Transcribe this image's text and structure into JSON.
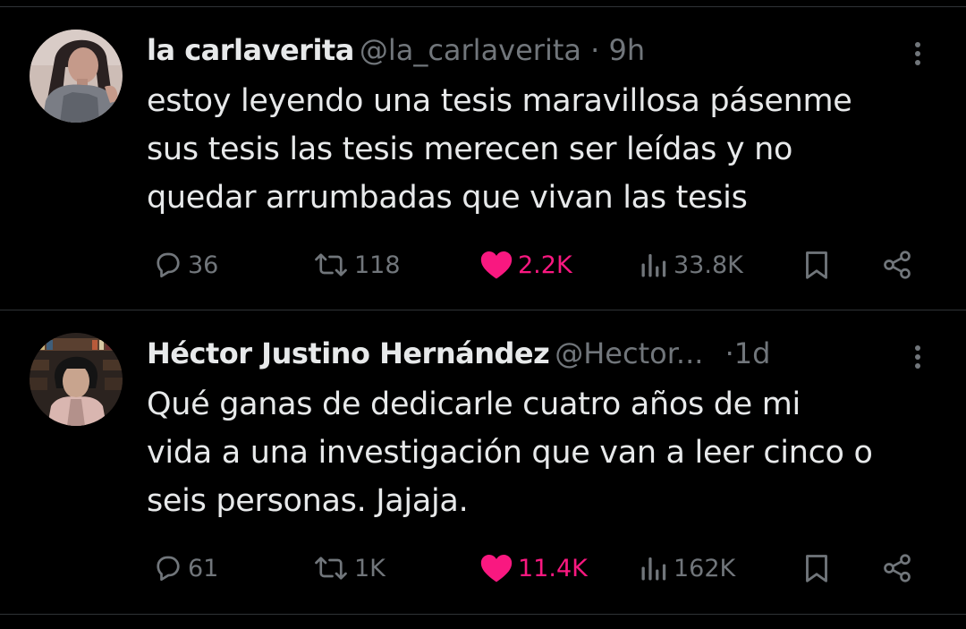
{
  "colors": {
    "background": "#000000",
    "text": "#e7e9ea",
    "muted": "#71767b",
    "like_active": "#f91880",
    "divider": "#2f3336"
  },
  "tweets": [
    {
      "name": "la carlaverita",
      "handle": "@la_carlaverita",
      "separator": " · ",
      "time": "9h",
      "text_lines": [
        "estoy leyendo una tesis maravillosa pásenme",
        "sus tesis las tesis merecen ser leídas y no",
        "quedar arrumbadas que vivan las tesis"
      ],
      "avatar_icon": "profile-photo-woman",
      "replies": "36",
      "retweets": "118",
      "likes": "2.2K",
      "liked": true,
      "views": "33.8K"
    },
    {
      "name": "Héctor Justino Hernández",
      "handle": "@Hector...",
      "separator": " ·",
      "time": "1d",
      "text_lines": [
        "Qué ganas de dedicarle cuatro años de mi",
        "vida a una investigación que van a leer cinco o",
        "seis personas. Jajaja."
      ],
      "avatar_icon": "profile-photo-man-bookshelf",
      "replies": "61",
      "retweets": "1K",
      "likes": "11.4K",
      "liked": true,
      "views": "162K"
    }
  ],
  "icons": {
    "reply": "reply-icon",
    "retweet": "retweet-icon",
    "like": "heart-icon",
    "views": "views-bar-chart-icon",
    "bookmark": "bookmark-icon",
    "share": "share-icon",
    "more": "more-vertical-icon"
  }
}
